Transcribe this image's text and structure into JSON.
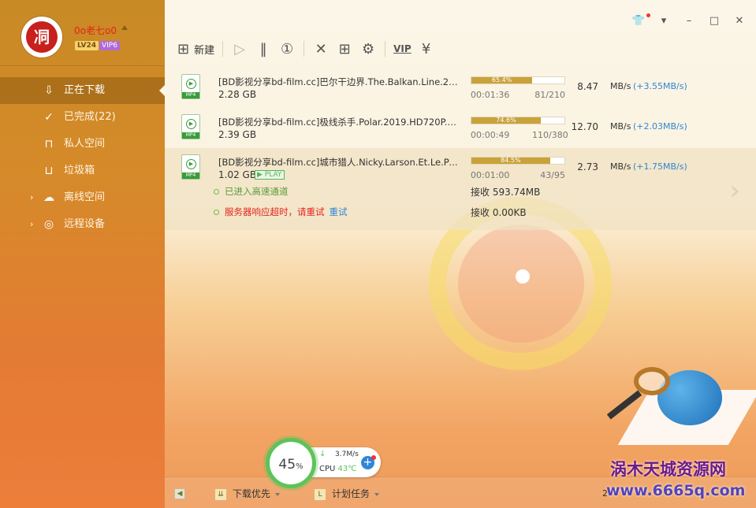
{
  "user": {
    "name": "0o老七o0",
    "level": "LV24",
    "vip": "VIP6",
    "avatar_char": "㓊"
  },
  "sidebar": {
    "items": [
      {
        "label": "正在下载",
        "icon": "download-icon"
      },
      {
        "label": "已完成(22)",
        "icon": "check-circle-icon"
      },
      {
        "label": "私人空间",
        "icon": "lock-icon"
      },
      {
        "label": "垃圾箱",
        "icon": "trash-icon"
      },
      {
        "label": "离线空间",
        "icon": "cloud-download-icon"
      },
      {
        "label": "远程设备",
        "icon": "globe-icon"
      }
    ]
  },
  "toolbar": {
    "new_label": "新建",
    "vip_label": "VIP"
  },
  "tasks": [
    {
      "name": "[BD影视分享bd-film.cc]巴尔干边界.The.Balkan.Line.201...",
      "size": "2.28 GB",
      "ext": "MP4",
      "progress_text": "65.4%",
      "progress": 65.4,
      "time_left": "00:01:36",
      "blocks": "81/210",
      "speed": "8.47",
      "unit": "MB/s",
      "boost": "(+3.55MB/s)"
    },
    {
      "name": "[BD影视分享bd-film.cc]极线杀手.Polar.2019.HD720P.中...",
      "size": "2.39 GB",
      "ext": "MP4",
      "progress_text": "74.6%",
      "progress": 74.6,
      "time_left": "00:00:49",
      "blocks": "110/380",
      "speed": "12.70",
      "unit": "MB/s",
      "boost": "(+2.03MB/s)"
    },
    {
      "name": "[BD影视分享bd-film.cc]城市猎人.Nicky.Larson.Et.Le.Parf...",
      "size": "1.02 GB",
      "ext": "MP4",
      "play": "PLAY",
      "progress_text": "84.5%",
      "progress": 84.5,
      "time_left": "00:01:00",
      "blocks": "43/95",
      "speed": "2.73",
      "unit": "MB/s",
      "boost": "(+1.75MB/s)",
      "channel_text": "已进入高速通道",
      "channel_recv": "接收 593.74MB",
      "server_text": "服务器响应超时，请重试",
      "retry_text": "重试",
      "server_recv": "接收 0.00KB"
    }
  ],
  "footer": {
    "priority_label": "下载优先",
    "plan_label": "计划任务",
    "right_text": "2"
  },
  "widget": {
    "percent": "45",
    "percent_sign": "%",
    "speed": "3.7M/s",
    "cpu_label": "CPU",
    "cpu_temp": "43℃"
  },
  "watermark": {
    "line1": "涡木天城资源网",
    "line2": "www.6665q.com"
  }
}
